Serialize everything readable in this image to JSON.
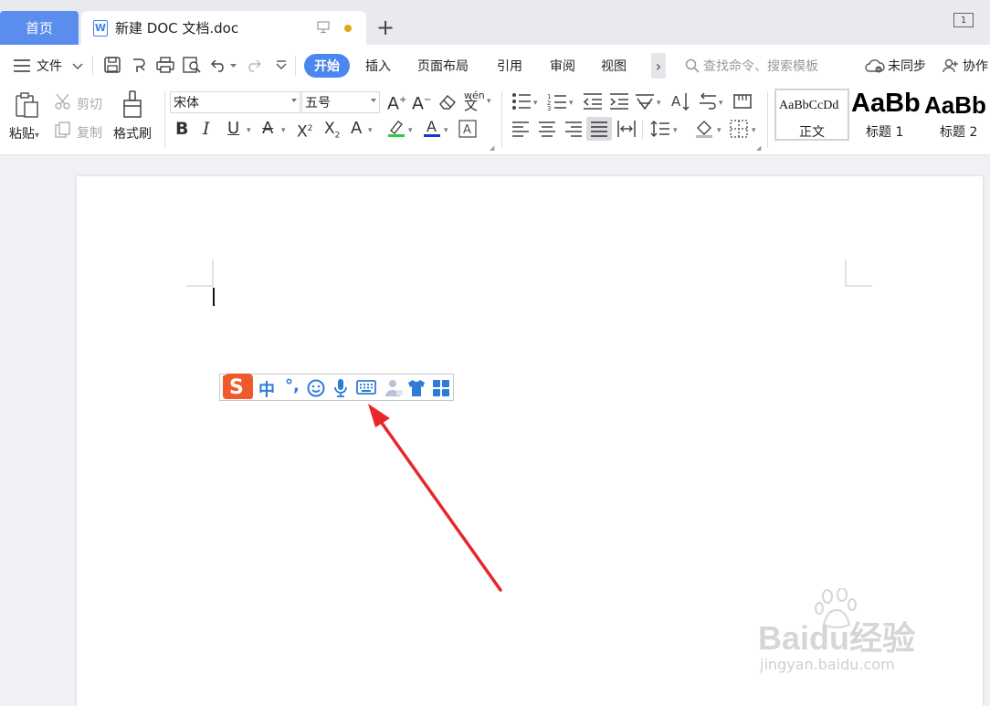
{
  "tabs": {
    "home": "首页",
    "doc_title": "新建 DOC 文档.doc",
    "doc_icon": "W",
    "new_tab": "+",
    "window_count": "1"
  },
  "menu": {
    "file": "文件",
    "items": [
      "开始",
      "插入",
      "页面布局",
      "引用",
      "审阅",
      "视图"
    ],
    "more": "›",
    "search_placeholder": "查找命令、搜索模板",
    "sync": "未同步",
    "collab": "协作"
  },
  "ribbon": {
    "paste": "粘贴",
    "cut": "剪切",
    "copy": "复制",
    "format_painter": "格式刷",
    "font_name": "宋体",
    "font_size": "五号",
    "pinyin": "wén",
    "styles": [
      {
        "sample": "AaBbCcDd",
        "label": "正文"
      },
      {
        "sample": "AaBb",
        "label": "标题 1"
      },
      {
        "sample": "AaBb",
        "label": "标题 2"
      }
    ]
  },
  "ime_toolbar": {
    "logo": "S",
    "mode": "中",
    "punct": "°,",
    "icons": [
      "logo-icon",
      "chinese-mode-icon",
      "punctuation-icon",
      "emoji-icon",
      "microphone-icon",
      "keyboard-icon",
      "account-icon",
      "skin-icon",
      "toolbox-icon"
    ]
  },
  "watermark": {
    "brand": "Baidu经验",
    "url": "jingyan.baidu.com"
  },
  "colors": {
    "accent": "#4a87ee",
    "home_tab": "#5b8dee",
    "arrow": "#e8262c",
    "ime_blue": "#2f7bd8",
    "ime_logo": "#f0592a"
  }
}
